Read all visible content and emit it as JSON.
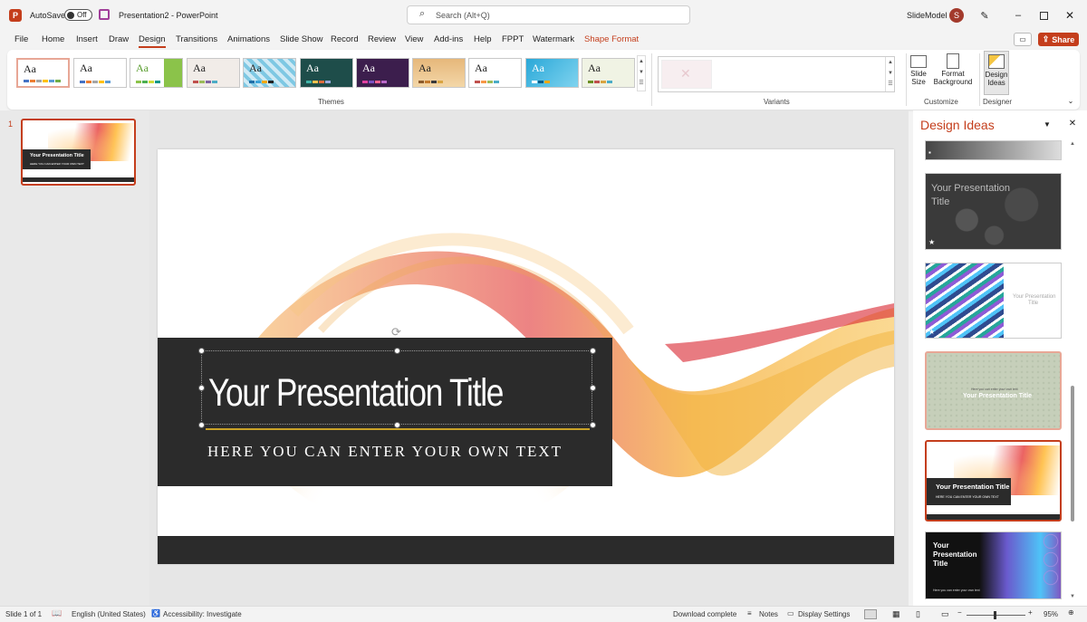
{
  "app": {
    "autosave_label": "AutoSave",
    "autosave_state": "Off",
    "doc_title": "Presentation2  -  PowerPoint",
    "search_placeholder": "Search (Alt+Q)",
    "account_name": "SlideModel",
    "avatar_initial": "S"
  },
  "menu": {
    "tabs": [
      "File",
      "Home",
      "Insert",
      "Draw",
      "Design",
      "Transitions",
      "Animations",
      "Slide Show",
      "Record",
      "Review",
      "View",
      "Add-ins",
      "Help",
      "FPPT",
      "Watermark",
      "Shape Format"
    ],
    "active": "Design",
    "share_label": "Share"
  },
  "ribbon": {
    "themes_label": "Themes",
    "variants_label": "Variants",
    "customize_label": "Customize",
    "designer_label": "Designer",
    "slide_size_line1": "Slide",
    "slide_size_line2": "Size",
    "format_bg_line1": "Format",
    "format_bg_line2": "Background",
    "design_ideas_line1": "Design",
    "design_ideas_line2": "Ideas",
    "theme_sample": "Aa"
  },
  "thumbnails": {
    "slide_number": "1",
    "mini_title": "Your Presentation Title",
    "mini_sub": "HERE YOU CAN ENTER YOUR OWN TEXT"
  },
  "slide": {
    "title": "Your Presentation Title",
    "subtitle": "HERE YOU CAN ENTER YOUR OWN TEXT"
  },
  "design_ideas": {
    "header": "Design Ideas",
    "idea2_title_line1": "Your Presentation",
    "idea2_title_line2": "Title",
    "idea3_title_line1": "Your Presentation",
    "idea3_title_line2": "Title",
    "idea4_small": "Here you can enter your own text",
    "idea4_title": "Your Presentation Title",
    "idea5_title": "Your Presentation Title",
    "idea5_sub": "HERE YOU CAN ENTER YOUR OWN TEXT",
    "idea6_title_line1": "Your",
    "idea6_title_line2": "Presentation",
    "idea6_title_line3": "Title",
    "idea6_sub": "Here you can enter your own text"
  },
  "status": {
    "slide_info": "Slide 1 of 1",
    "language": "English (United States)",
    "accessibility": "Accessibility: Investigate",
    "download": "Download complete",
    "notes": "Notes",
    "display_settings": "Display Settings",
    "zoom": "95%"
  },
  "colors": {
    "accent": "#c43e1c",
    "dark_band": "#2b2b2b",
    "title_underline": "#c9a227"
  }
}
